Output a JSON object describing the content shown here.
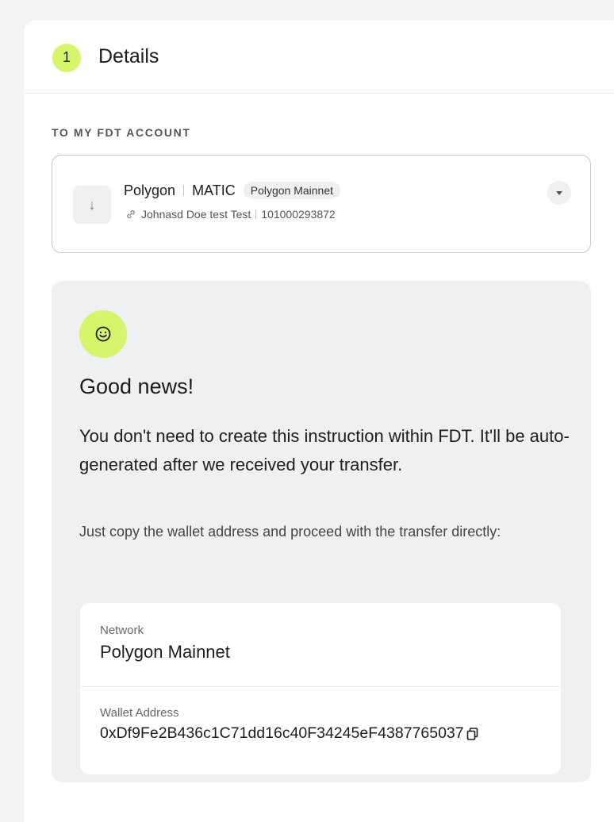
{
  "header": {
    "step_number": "1",
    "title": "Details"
  },
  "account_section": {
    "label": "TO MY FDT ACCOUNT",
    "selected": {
      "network_name": "Polygon",
      "currency": "MATIC",
      "network_chip": "Polygon Mainnet",
      "account_name": "Johnasd Doe test Test",
      "account_number": "101000293872"
    }
  },
  "info_card": {
    "title": "Good news!",
    "lead": "You don't need to create this instruction within FDT. It'll be auto-generated after we received your transfer.",
    "sub": "Just copy the wallet address and proceed with the transfer directly:",
    "network_label": "Network",
    "network_value": "Polygon Mainnet",
    "wallet_label": "Wallet Address",
    "wallet_value": "0xDf9Fe2B436c1C71dd16c40F34245eF4387765037"
  },
  "icons": {
    "step": "step-number-badge",
    "arrow": "arrow-down-icon",
    "link": "link-icon",
    "dropdown": "chevron-down-icon",
    "smile": "smile-icon",
    "copy": "copy-icon"
  },
  "colors": {
    "accent": "#d6f56a",
    "card_bg": "#eef0f1",
    "page_bg": "#f3f4f5"
  }
}
